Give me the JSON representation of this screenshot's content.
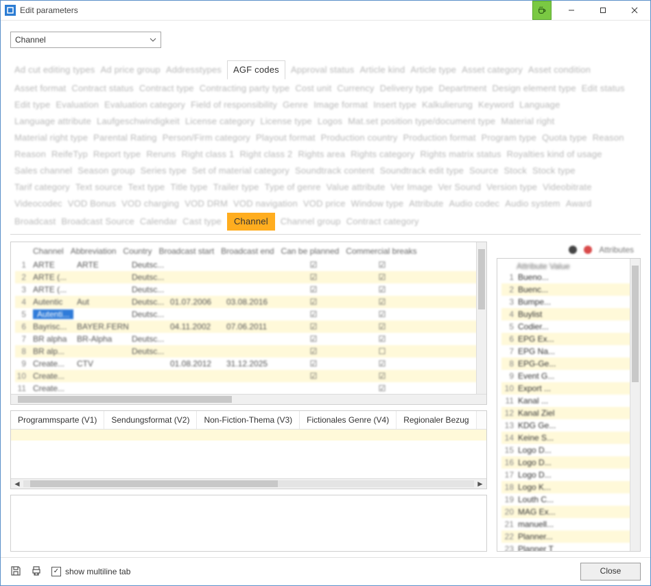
{
  "window": {
    "title": "Edit parameters"
  },
  "dropdown": {
    "selected": "Channel"
  },
  "tabs": {
    "active_clear": "AGF codes",
    "highlight": "Channel",
    "blurred": [
      "Ad cut editing types",
      "Ad price group",
      "Addresstypes",
      "Approval status",
      "Article kind",
      "Article type",
      "Asset category",
      "Asset condition",
      "Asset format",
      "Contract status",
      "Contract type",
      "Contracting party type",
      "Cost unit",
      "Currency",
      "Delivery type",
      "Department",
      "Design element type",
      "Edit status",
      "Edit type",
      "Evaluation",
      "Evaluation category",
      "Field of responsibility",
      "Genre",
      "Image format",
      "Insert type",
      "Kalkulierung",
      "Keyword",
      "Language",
      "Language attribute",
      "Laufgeschwindigkeit",
      "License category",
      "License type",
      "Logos",
      "Mat.set position type/document type",
      "Material right",
      "Material right type",
      "Parental Rating",
      "Person/Firm category",
      "Playout format",
      "Production country",
      "Production format",
      "Program type",
      "Quota type",
      "Reason",
      "Reason",
      "ReifeTyp",
      "Report type",
      "Reruns",
      "Right class 1",
      "Right class 2",
      "Rights area",
      "Rights category",
      "Rights matrix status",
      "Royalties kind of usage",
      "Sales channel",
      "Season group",
      "Series type",
      "Set of material category",
      "Soundtrack content",
      "Soundtrack edit type",
      "Source",
      "Stock",
      "Stock type",
      "Tarif category",
      "Text source",
      "Text type",
      "Title type",
      "Trailer type",
      "Type of genre",
      "Value attribute",
      "Ver Image",
      "Ver Sound",
      "Version type",
      "Videobitrate",
      "Videocodec",
      "VOD Bonus",
      "VOD charging",
      "VOD DRM",
      "VOD navigation",
      "VOD price",
      "Window type",
      "Attribute",
      "Audio codec",
      "Audio system",
      "Award",
      "Broadcast",
      "Broadcast Source",
      "Calendar",
      "Cast type",
      "Channel group",
      "Contract category"
    ]
  },
  "grid": {
    "headers": [
      "Channel",
      "Abbreviation",
      "Country",
      "Broadcast start",
      "Broadcast end",
      "Can be planned",
      "Commercial breaks"
    ],
    "rows": [
      {
        "n": 1,
        "c1": "ARTE",
        "c2": "ARTE",
        "c3": "Deutsc...",
        "c4": "",
        "c5": "",
        "ck1": "☑",
        "ck2": "☑",
        "alt": false
      },
      {
        "n": 2,
        "c1": "ARTE (...",
        "c2": "",
        "c3": "Deutsc...",
        "c4": "",
        "c5": "",
        "ck1": "☑",
        "ck2": "☑",
        "alt": true
      },
      {
        "n": 3,
        "c1": "ARTE (...",
        "c2": "",
        "c3": "Deutsc...",
        "c4": "",
        "c5": "",
        "ck1": "☑",
        "ck2": "☑",
        "alt": false
      },
      {
        "n": 4,
        "c1": "Autentic",
        "c2": "Aut",
        "c3": "Deutsc...",
        "c4": "01.07.2006",
        "c5": "03.08.2016",
        "ck1": "☑",
        "ck2": "☑",
        "alt": true
      },
      {
        "n": 5,
        "c1": "Autenti...",
        "c2": "",
        "c3": "Deutsc...",
        "c4": "",
        "c5": "",
        "ck1": "☑",
        "ck2": "☑",
        "alt": false,
        "sel": true
      },
      {
        "n": 6,
        "c1": "Bayrisc...",
        "c2": "BAYER.FERN",
        "c3": "",
        "c4": "04.11.2002",
        "c5": "07.06.2011",
        "ck1": "☑",
        "ck2": "☑",
        "alt": true
      },
      {
        "n": 7,
        "c1": "BR alpha",
        "c2": "BR-Alpha",
        "c3": "Deutsc...",
        "c4": "",
        "c5": "",
        "ck1": "☑",
        "ck2": "☑",
        "alt": false
      },
      {
        "n": 8,
        "c1": "BR alp...",
        "c2": "",
        "c3": "Deutsc...",
        "c4": "",
        "c5": "",
        "ck1": "☑",
        "ck2": "☐",
        "alt": true
      },
      {
        "n": 9,
        "c1": "Create...",
        "c2": "CTV",
        "c3": "",
        "c4": "01.08.2012",
        "c5": "31.12.2025",
        "ck1": "☑",
        "ck2": "☑",
        "alt": false
      },
      {
        "n": 10,
        "c1": "Create...",
        "c2": "",
        "c3": "",
        "c4": "",
        "c5": "",
        "ck1": "☑",
        "ck2": "☑",
        "alt": true
      },
      {
        "n": 11,
        "c1": "Create...",
        "c2": "",
        "c3": "",
        "c4": "",
        "c5": "",
        "ck1": "",
        "ck2": "☑",
        "alt": false
      }
    ]
  },
  "subtabs": [
    "Programmsparte (V1)",
    "Sendungsformat (V2)",
    "Non-Fiction-Thema (V3)",
    "Fictionales Genre (V4)",
    "Regionaler Bezug"
  ],
  "attributes": {
    "header": "Attribute   Value",
    "title": "Attributes",
    "rows": [
      {
        "n": 1,
        "t": "Bueno...",
        "alt": false
      },
      {
        "n": 2,
        "t": "Buenc...",
        "alt": true
      },
      {
        "n": 3,
        "t": "Bumpe...",
        "alt": false
      },
      {
        "n": 4,
        "t": "Buylist",
        "alt": true
      },
      {
        "n": 5,
        "t": "Codier...",
        "alt": false
      },
      {
        "n": 6,
        "t": "EPG Ex...",
        "alt": true
      },
      {
        "n": 7,
        "t": "EPG Na...",
        "alt": false
      },
      {
        "n": 8,
        "t": "EPG-Ge...",
        "alt": true
      },
      {
        "n": 9,
        "t": "Event G...",
        "alt": false
      },
      {
        "n": 10,
        "t": "Export ...",
        "alt": true
      },
      {
        "n": 11,
        "t": "Kanal ...",
        "alt": false
      },
      {
        "n": 12,
        "t": "Kanal Ziel",
        "alt": true
      },
      {
        "n": 13,
        "t": "KDG Ge...",
        "alt": false
      },
      {
        "n": 14,
        "t": "Keine S...",
        "alt": true
      },
      {
        "n": 15,
        "t": "Logo D...",
        "alt": false
      },
      {
        "n": 16,
        "t": "Logo D...",
        "alt": true
      },
      {
        "n": 17,
        "t": "Logo D...",
        "alt": false
      },
      {
        "n": 18,
        "t": "Logo K...",
        "alt": true
      },
      {
        "n": 19,
        "t": "Louth C...",
        "alt": false
      },
      {
        "n": 20,
        "t": "MAG Ex...",
        "alt": true
      },
      {
        "n": 21,
        "t": "manuell...",
        "alt": false
      },
      {
        "n": 22,
        "t": "Planner...",
        "alt": true
      },
      {
        "n": 23,
        "t": "Planner T",
        "alt": false
      }
    ]
  },
  "footer": {
    "checkbox_label": "show multiline tab",
    "close": "Close"
  }
}
